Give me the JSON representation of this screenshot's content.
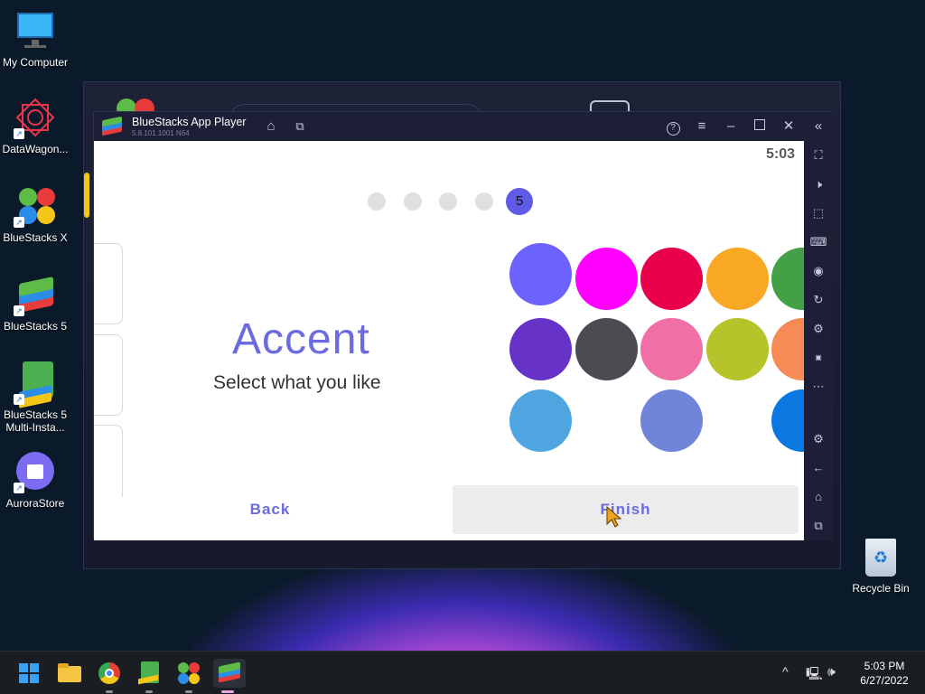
{
  "desktop": {
    "icons": [
      {
        "label": "My Computer"
      },
      {
        "label": "DataWagon..."
      },
      {
        "label": "BlueStacks X"
      },
      {
        "label": "BlueStacks 5"
      },
      {
        "label": "BlueStacks 5 Multi-Insta..."
      },
      {
        "label": "AuroraStore"
      }
    ],
    "recycle_bin": "Recycle Bin"
  },
  "window": {
    "title": "BlueStacks App Player",
    "version": "5.8.101.1001 N64",
    "icons": [
      "home-icon",
      "multi-instance-icon",
      "help-icon",
      "menu-icon",
      "minimize-icon",
      "maximize-icon",
      "close-icon",
      "collapse-sidebar-icon"
    ]
  },
  "screen": {
    "time": "5:03",
    "step_active": "5",
    "heading": "Accent",
    "subheading": "Select what you like",
    "back_label": "Back",
    "finish_label": "Finish",
    "swatches": [
      "#6c63ff",
      "#ff00ff",
      "#e8004a",
      "#f9a825",
      "#43a047",
      "#6632c8",
      "#4a4c52",
      "#ef6fa6",
      "#b5c42a",
      "#f78b55",
      "#4ea5e0",
      "#7084d9",
      "#0a78e0"
    ]
  },
  "sidebar": {
    "icons": [
      "fullscreen-icon",
      "volume-icon",
      "pointer-icon",
      "keyboard-icon",
      "record-icon",
      "rotate-icon",
      "gamepad-icon",
      "apk-icon",
      "more-icon",
      "settings-icon",
      "back-icon",
      "home-icon",
      "recents-icon"
    ]
  },
  "taskbar": {
    "apps": [
      "start-icon",
      "file-explorer-icon",
      "chrome-icon",
      "bluestacks-multi-icon",
      "bluestacks-x-icon",
      "bluestacks-icon"
    ],
    "time": "5:03 PM",
    "date": "6/27/2022"
  }
}
